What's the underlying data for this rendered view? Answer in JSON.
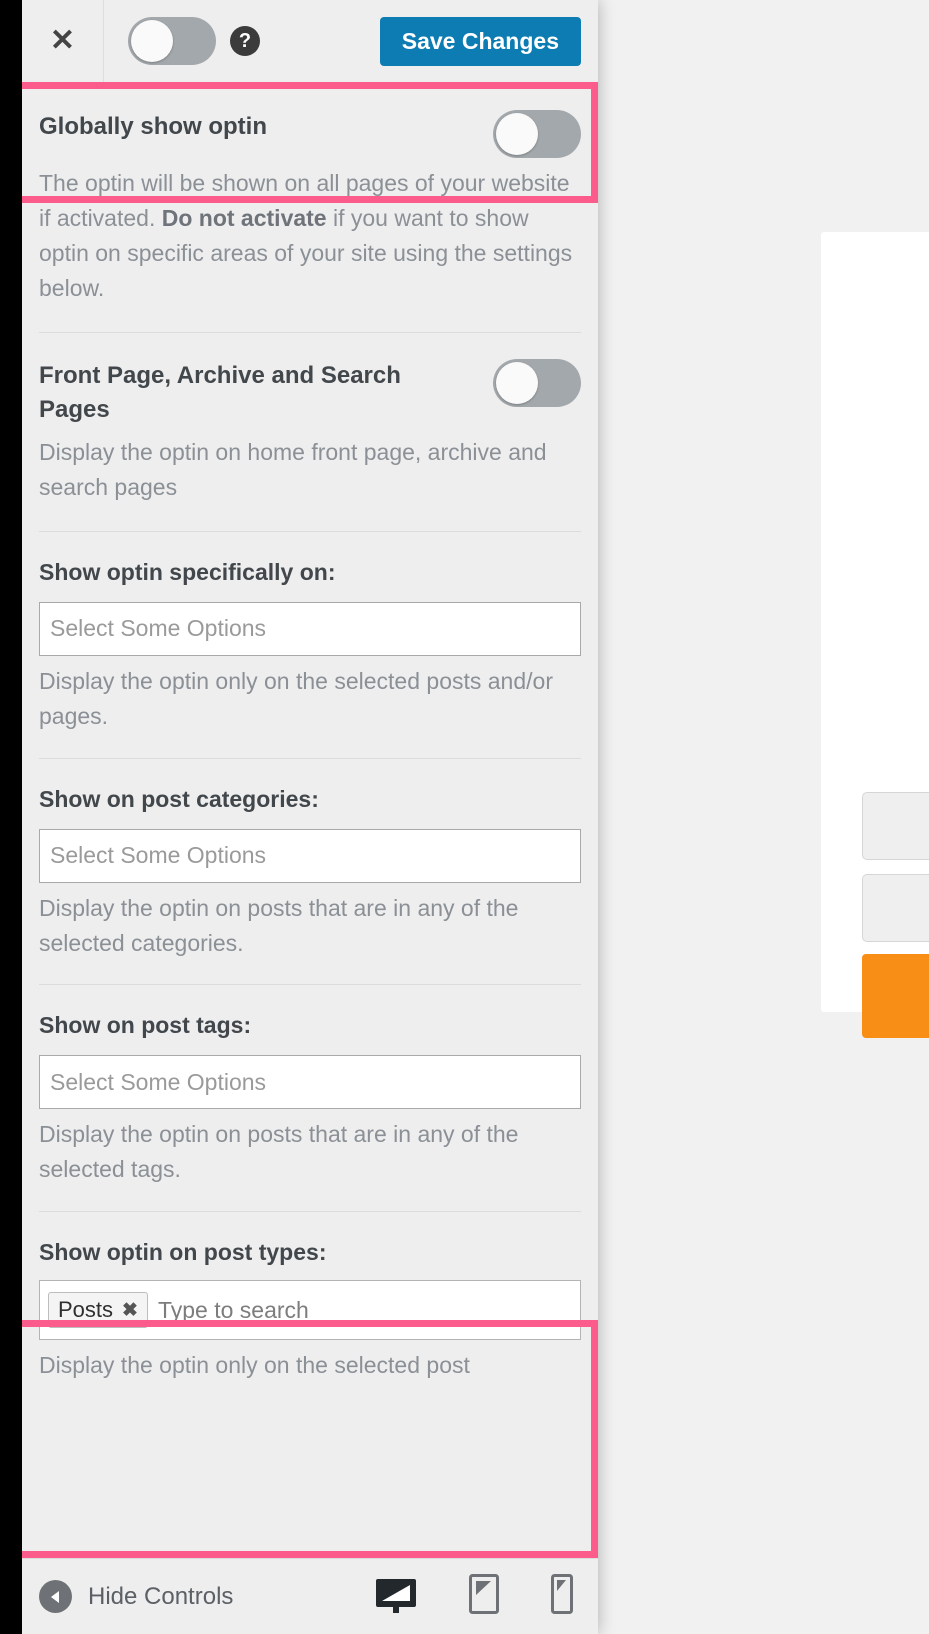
{
  "header": {
    "close_icon": "close-icon",
    "master_toggle": {
      "state": "off",
      "label": "optin-enable-toggle"
    },
    "help_icon": "question-mark-icon",
    "help_glyph": "?",
    "save_label": "Save Changes",
    "accent_blue": "#0c7cb2"
  },
  "highlights": {
    "color": "#fb5c8c",
    "regions": [
      "globally-show-optin",
      "show-optin-on-post-types"
    ]
  },
  "settings": {
    "global": {
      "title": "Globally show optin",
      "toggle_state": "off",
      "desc_part1": "The optin will be shown on all pages of your website if activated. ",
      "desc_bold": "Do not activate",
      "desc_part2": " if you want to show optin on specific areas of your site using the settings below."
    },
    "front_page": {
      "title": "Front Page, Archive and Search Pages",
      "toggle_state": "off",
      "desc": "Display the optin on home front page, archive and search pages"
    },
    "specific": {
      "label": "Show optin specifically on:",
      "placeholder": "Select Some Options",
      "desc": "Display the optin only on the selected posts and/or pages."
    },
    "categories": {
      "label": "Show on post categories:",
      "placeholder": "Select Some Options",
      "desc": "Display the optin on posts that are in any of the selected categories."
    },
    "tags": {
      "label": "Show on post tags:",
      "placeholder": "Select Some Options",
      "desc": "Display the optin on posts that are in any of the selected tags."
    },
    "post_types": {
      "label": "Show optin on post types:",
      "chips": [
        {
          "label": "Posts",
          "remove_glyph": "✖"
        }
      ],
      "placeholder": "Type to search",
      "desc": "Display the optin only on the selected post"
    }
  },
  "footer": {
    "hide_controls_label": "Hide Controls",
    "back_icon": "back-arrow-circle-icon",
    "devices": [
      {
        "name": "desktop-preview-icon",
        "active": true
      },
      {
        "name": "tablet-preview-icon",
        "active": false
      },
      {
        "name": "mobile-preview-icon",
        "active": false
      }
    ]
  },
  "preview": {
    "card_background": "#ffffff",
    "button_color": "#f98e17",
    "field_color": "#efefef"
  }
}
